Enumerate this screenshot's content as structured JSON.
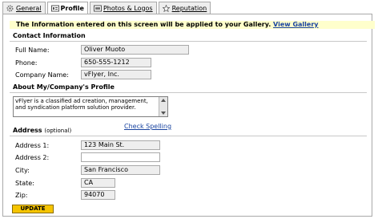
{
  "tabs": [
    {
      "label": "General",
      "icon": "gear-icon",
      "active": false
    },
    {
      "label": "Profile",
      "icon": "profile-card-icon",
      "active": true
    },
    {
      "label": "Photos & Logos",
      "icon": "photo-icon",
      "active": false
    },
    {
      "label": "Reputation",
      "icon": "star-icon",
      "active": false
    }
  ],
  "notice": {
    "text": "The Information entered on this screen will be applied to your Gallery.",
    "link": "View Gallery"
  },
  "contact": {
    "title": "Contact Information",
    "full_name_label": "Full Name:",
    "full_name": "Oliver Muoto",
    "phone_label": "Phone:",
    "phone": "650-555-1212",
    "company_label": "Company Name:",
    "company": "vFlyer, Inc."
  },
  "profile": {
    "title": "About My/Company's Profile",
    "text": "vFlyer is a classified ad creation, management, and syndication platform solution provider.",
    "spell_check": "Check Spelling"
  },
  "address": {
    "title": "Address",
    "optional": "(optional)",
    "address1_label": "Address 1:",
    "address1": "123 Main St.",
    "address2_label": "Address 2:",
    "address2": "",
    "city_label": "City:",
    "city": "San Francisco",
    "state_label": "State:",
    "state": "CA",
    "zip_label": "Zip:",
    "zip": "94070"
  },
  "update_button": "UPDATE",
  "colors": {
    "notice_bg": "#ffffcc",
    "link": "#1a44a0",
    "button": "#f5c400"
  }
}
